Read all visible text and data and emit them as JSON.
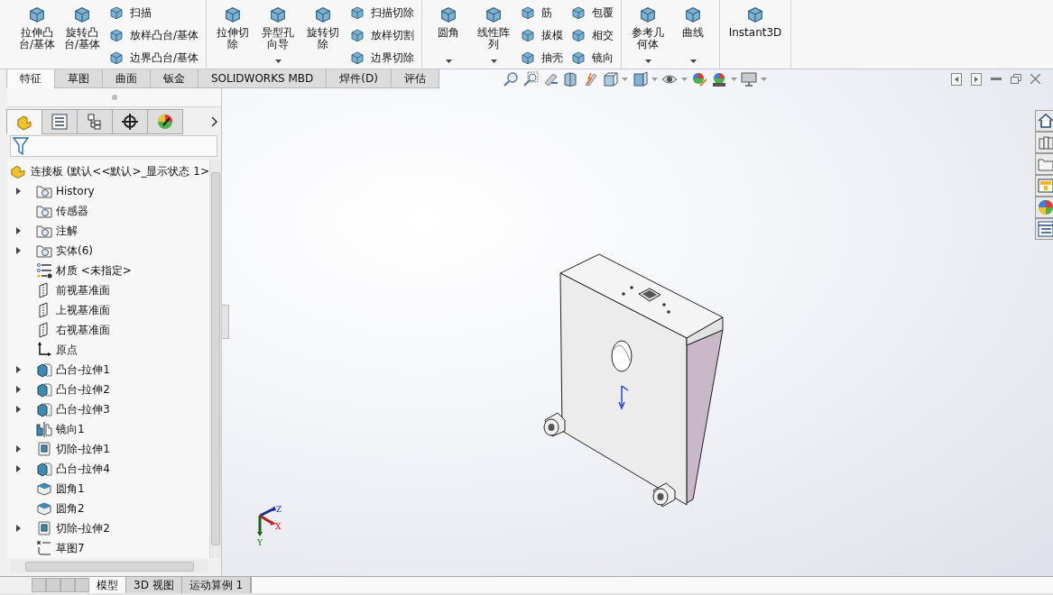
{
  "ribbon": {
    "groups": [
      {
        "items": [
          {
            "kind": "large",
            "label": "拉伸凸台/基体",
            "dropdown": false
          },
          {
            "kind": "large",
            "label": "旋转凸台/基体",
            "dropdown": false
          },
          {
            "kind": "stack",
            "items": [
              {
                "label": "扫描"
              },
              {
                "label": "放样凸台/基体"
              },
              {
                "label": "边界凸台/基体"
              }
            ]
          }
        ]
      },
      {
        "items": [
          {
            "kind": "large",
            "label": "拉伸切除",
            "dropdown": false
          },
          {
            "kind": "large",
            "label": "异型孔向导",
            "dropdown": true
          },
          {
            "kind": "large",
            "label": "旋转切除",
            "dropdown": false
          },
          {
            "kind": "stack",
            "items": [
              {
                "label": "扫描切除"
              },
              {
                "label": "放样切割"
              },
              {
                "label": "边界切除"
              }
            ]
          }
        ]
      },
      {
        "items": [
          {
            "kind": "large",
            "label": "圆角",
            "dropdown": true
          },
          {
            "kind": "large",
            "label": "线性阵列",
            "dropdown": true
          },
          {
            "kind": "stack",
            "items": [
              {
                "label": "筋"
              },
              {
                "label": "拔模"
              },
              {
                "label": "抽壳"
              }
            ]
          },
          {
            "kind": "stack",
            "items": [
              {
                "label": "包覆"
              },
              {
                "label": "相交"
              },
              {
                "label": "镜向"
              }
            ]
          }
        ]
      },
      {
        "items": [
          {
            "kind": "large",
            "label": "参考几何体",
            "dropdown": true
          },
          {
            "kind": "large",
            "label": "曲线",
            "dropdown": true
          }
        ]
      },
      {
        "items": [
          {
            "kind": "large",
            "label": "Instant3D",
            "dropdown": false
          }
        ]
      }
    ]
  },
  "command_tabs": [
    {
      "label": "特征",
      "selected": true
    },
    {
      "label": "草图",
      "selected": false
    },
    {
      "label": "曲面",
      "selected": false
    },
    {
      "label": "钣金",
      "selected": false
    },
    {
      "label": "SOLIDWORKS MBD",
      "selected": false
    },
    {
      "label": "焊件(D)",
      "selected": false
    },
    {
      "label": "评估",
      "selected": false
    }
  ],
  "feature_manager_tabs": [
    {
      "selected": true
    },
    {
      "selected": false
    },
    {
      "selected": false
    },
    {
      "selected": false
    },
    {
      "selected": false
    }
  ],
  "tree": {
    "root": "连接板 (默认<<默认>_显示状态 1>",
    "items": [
      {
        "kind": "folder",
        "label": "History",
        "expandable": true
      },
      {
        "kind": "folder",
        "label": "传感器",
        "expandable": false
      },
      {
        "kind": "folder",
        "label": "注解",
        "expandable": true
      },
      {
        "kind": "folder",
        "label": "实体(6)",
        "expandable": true
      },
      {
        "kind": "material",
        "label": "材质 <未指定>",
        "expandable": false
      },
      {
        "kind": "plane",
        "label": "前视基准面",
        "expandable": false
      },
      {
        "kind": "plane",
        "label": "上视基准面",
        "expandable": false
      },
      {
        "kind": "plane",
        "label": "右视基准面",
        "expandable": false
      },
      {
        "kind": "origin",
        "label": "原点",
        "expandable": false
      },
      {
        "kind": "boss",
        "label": "凸台-拉伸1",
        "expandable": true
      },
      {
        "kind": "boss",
        "label": "凸台-拉伸2",
        "expandable": true
      },
      {
        "kind": "boss",
        "label": "凸台-拉伸3",
        "expandable": true
      },
      {
        "kind": "mirror",
        "label": "镜向1",
        "expandable": false
      },
      {
        "kind": "cut",
        "label": "切除-拉伸1",
        "expandable": true
      },
      {
        "kind": "boss",
        "label": "凸台-拉伸4",
        "expandable": true
      },
      {
        "kind": "fillet",
        "label": "圆角1",
        "expandable": false
      },
      {
        "kind": "fillet",
        "label": "圆角2",
        "expandable": false
      },
      {
        "kind": "cut",
        "label": "切除-拉伸2",
        "expandable": true
      },
      {
        "kind": "sketch",
        "label": "草图7",
        "expandable": false
      }
    ]
  },
  "viewport": {
    "triad": {
      "z": "Z",
      "x": "X",
      "y": "Y"
    }
  },
  "bottom_tabs": [
    {
      "label": "模型",
      "selected": true
    },
    {
      "label": "3D 视图",
      "selected": false
    },
    {
      "label": "运动算例 1",
      "selected": false
    }
  ]
}
